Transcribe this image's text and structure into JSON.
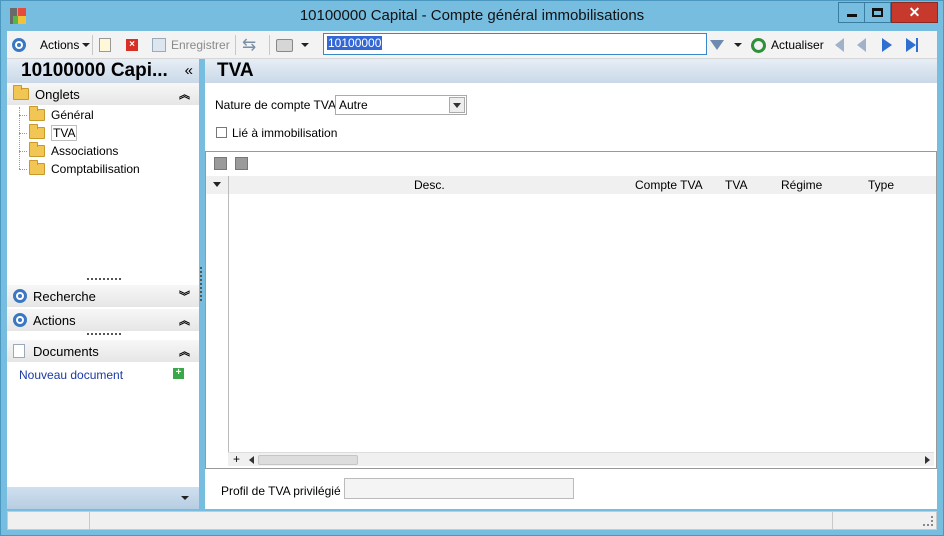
{
  "window": {
    "title": "10100000 Capital -  Compte général immobilisations",
    "controls": {
      "minimize": "—",
      "maximize": "□",
      "close": "✕"
    }
  },
  "toolbar": {
    "actions_label": "Actions",
    "save_label": "Enregistrer",
    "search_value": "10100000",
    "refresh_label": "Actualiser"
  },
  "left_panel": {
    "title": "10100000 Capi...",
    "collapse_glyph": "«",
    "tabs_section": "Onglets",
    "tabs": [
      {
        "label": "Général"
      },
      {
        "label": "TVA"
      },
      {
        "label": "Associations"
      },
      {
        "label": "Comptabilisation"
      }
    ],
    "search_section": "Recherche",
    "actions_section": "Actions",
    "documents_section": "Documents",
    "new_document": "Nouveau document"
  },
  "main": {
    "title": "TVA",
    "nature_label": "Nature de compte TVA :",
    "nature_value": "Autre",
    "linked_label": "Lié à immobilisation",
    "linked_checked": false,
    "grid_columns": [
      "Desc.",
      "Compte TVA",
      "TVA",
      "Régime",
      "Type"
    ],
    "grid_add_glyph": "+",
    "preferred_profile_label": "Profil de TVA privilégié :",
    "preferred_profile_value": ""
  },
  "colors": {
    "frame": "#76bde0",
    "header_gradient_top": "#e7eef6",
    "accent_blue": "#3b78c3",
    "close_red": "#c7392c",
    "link_blue": "#1a3aa6"
  }
}
